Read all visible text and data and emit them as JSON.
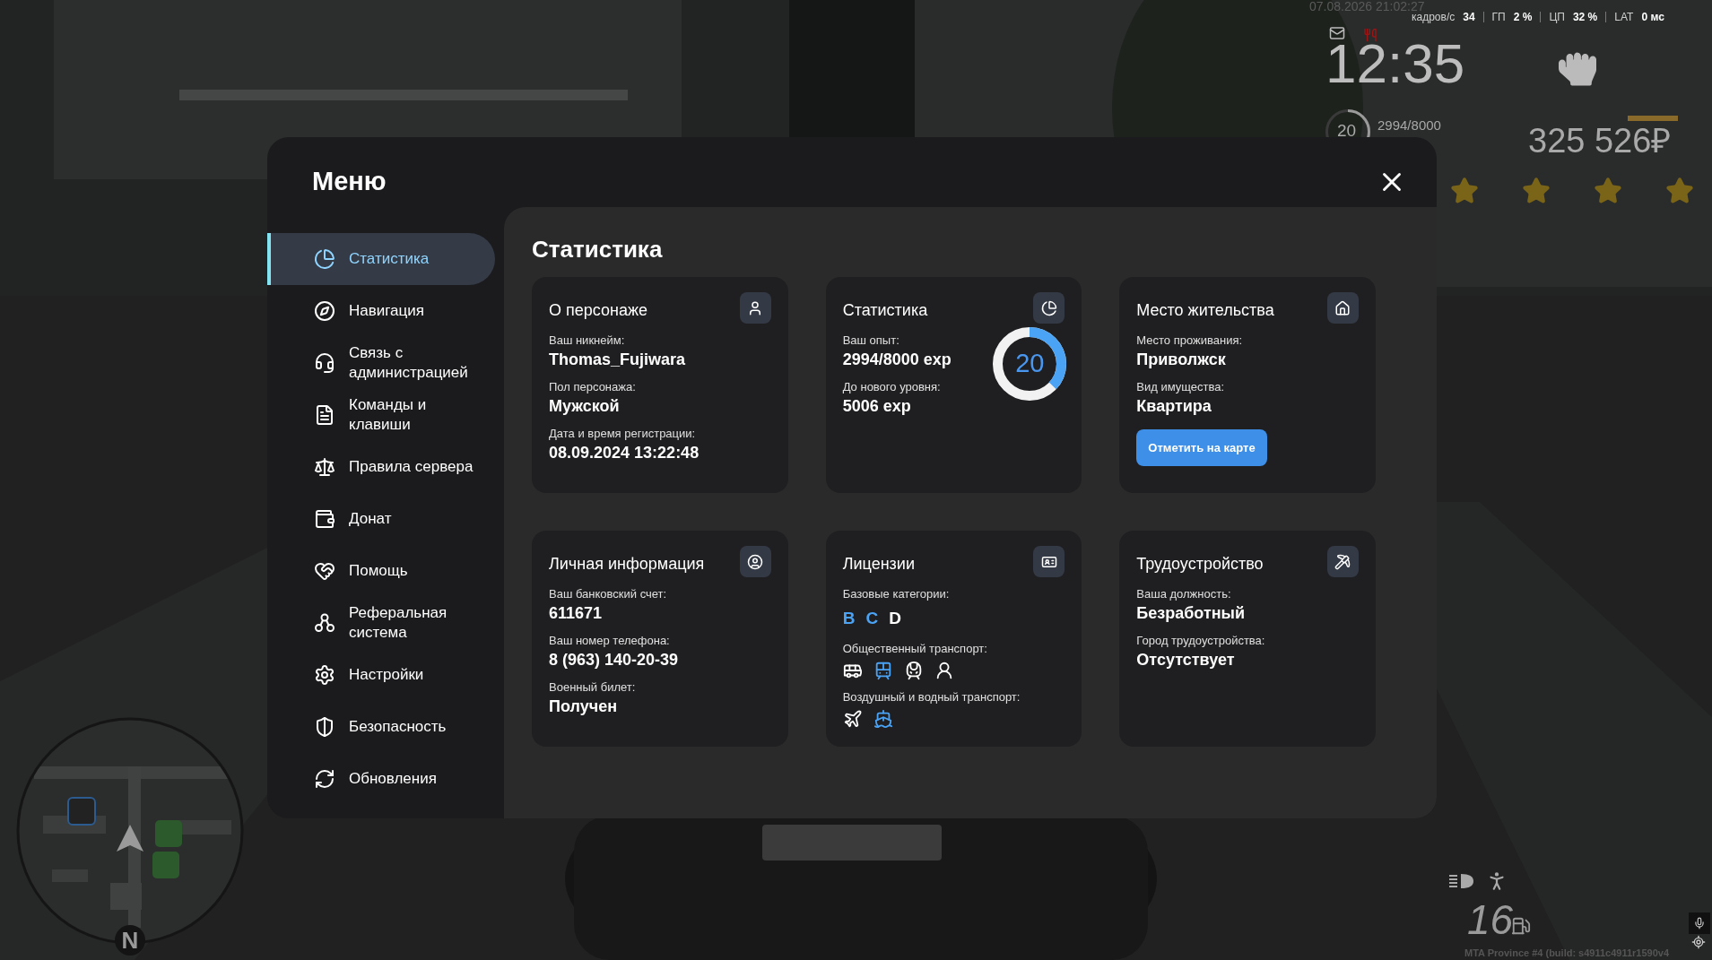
{
  "hud": {
    "datetime": "07.08.2026 21:02:27",
    "perf": [
      {
        "label": "кадров/с",
        "value": "34"
      },
      {
        "label": "ГП",
        "value": "2 %"
      },
      {
        "label": "ЦП",
        "value": "32 %"
      },
      {
        "label": "LAT",
        "value": "0 мс"
      }
    ],
    "clock": "12:35",
    "player_level": "20",
    "level_ring": {
      "level": 0.37
    },
    "exp": "2994/8000",
    "money": "325 526₽",
    "wanted": {
      "stars": 4
    },
    "fuel": "16",
    "build": "MTA Province #4 (build: s4911c4911r1590v4"
  },
  "minimap": {
    "compass": "N"
  },
  "menu": {
    "title": "Меню",
    "sidebar": [
      {
        "label": "Статистика",
        "selected": true
      },
      {
        "label": "Навигация",
        "selected": false
      },
      {
        "label": "Связь с администрацией",
        "selected": false
      },
      {
        "label": "Команды и клавиши",
        "selected": false
      },
      {
        "label": "Правила сервера",
        "selected": false
      },
      {
        "label": "Донат",
        "selected": false
      },
      {
        "label": "Помощь",
        "selected": false
      },
      {
        "label": "Реферальная система",
        "selected": false
      },
      {
        "label": "Настройки",
        "selected": false
      },
      {
        "label": "Безопасность",
        "selected": false
      },
      {
        "label": "Обновления",
        "selected": false
      }
    ],
    "content_title": "Статистика",
    "cards": [
      {
        "kind": "info",
        "title": "О персонаже",
        "fields": [
          {
            "label": "Ваш никнейм:",
            "value": "Thomas_Fujiwara"
          },
          {
            "label": "Пол персонажа:",
            "value": "Мужской"
          },
          {
            "label": "Дата и время регистрации:",
            "value": "08.09.2024 13:22:48"
          }
        ]
      },
      {
        "kind": "stats",
        "title": "Статистика",
        "fields": [
          {
            "label": "Ваш опыт:",
            "value": "2994/8000 exp"
          },
          {
            "label": "До нового уровня:",
            "value": "5006 exp"
          }
        ],
        "ring": {
          "value": "20",
          "level": 0.37
        }
      },
      {
        "kind": "info",
        "title": "Место жительства",
        "fields": [
          {
            "label": "Место проживания:",
            "value": "Приволжск"
          },
          {
            "label": "Вид имущества:",
            "value": "Квартира"
          }
        ],
        "button": "Отметить на карте"
      },
      {
        "kind": "info",
        "title": "Личная информация",
        "fields": [
          {
            "label": "Ваш банковский счет:",
            "value": "611671"
          },
          {
            "label": "Ваш номер телефона:",
            "value": "8 (963) 140-20-39"
          },
          {
            "label": "Военный билет:",
            "value": "Получен"
          }
        ]
      },
      {
        "kind": "licenses",
        "title": "Лицензии",
        "groups": [
          {
            "kind": "letters",
            "label": "Базовые категории:",
            "items": [
              {
                "text": "B",
                "active": true
              },
              {
                "text": "C",
                "active": true
              },
              {
                "text": "D",
                "active": false
              }
            ]
          },
          {
            "kind": "icons",
            "label": "Общественный транспорт:",
            "items": [
              {
                "active": false
              },
              {
                "active": true
              },
              {
                "active": false
              },
              {
                "active": false
              }
            ]
          },
          {
            "kind": "icons",
            "label": "Воздушный и водный транспорт:",
            "items": [
              {
                "active": false
              },
              {
                "active": true
              }
            ]
          }
        ]
      },
      {
        "kind": "info",
        "title": "Трудоустройство",
        "fields": [
          {
            "label": "Ваша должность:",
            "value": "Безработный"
          },
          {
            "label": "Город трудоустройства:",
            "value": "Отсутствует"
          }
        ]
      }
    ]
  }
}
